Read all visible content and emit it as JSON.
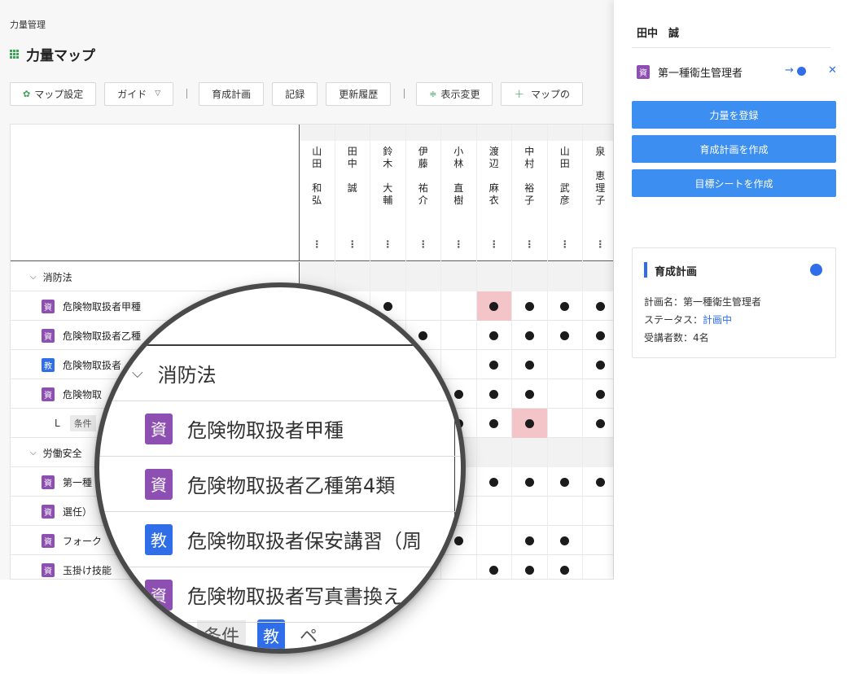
{
  "breadcrumb": "力量管理",
  "page_title": "力量マップ",
  "toolbar": {
    "map_settings": "マップ設定",
    "guide": "ガイド",
    "training_plan": "育成計画",
    "record": "記録",
    "history": "更新履歴",
    "display_change": "表示変更",
    "add_map": "マップの"
  },
  "members": [
    {
      "name": "山田 和弘",
      "chars": [
        "山",
        "田",
        "",
        "和",
        "弘"
      ]
    },
    {
      "name": "田中 誠",
      "chars": [
        "田",
        "中",
        "",
        "誠"
      ]
    },
    {
      "name": "鈴木 大輔",
      "chars": [
        "鈴",
        "木",
        "",
        "大",
        "輔"
      ]
    },
    {
      "name": "伊藤 祐介",
      "chars": [
        "伊",
        "藤",
        "",
        "祐",
        "介"
      ]
    },
    {
      "name": "小林 直樹",
      "chars": [
        "小",
        "林",
        "",
        "直",
        "樹"
      ]
    },
    {
      "name": "渡辺 麻衣",
      "chars": [
        "渡",
        "辺",
        "",
        "麻",
        "衣"
      ]
    },
    {
      "name": "中村 裕子",
      "chars": [
        "中",
        "村",
        "",
        "裕",
        "子"
      ]
    },
    {
      "name": "山田 武彦",
      "chars": [
        "山",
        "田",
        "",
        "武",
        "彦"
      ]
    },
    {
      "name": "泉 恵理子",
      "chars": [
        "泉",
        "",
        "恵",
        "理",
        "子"
      ]
    }
  ],
  "rows": [
    {
      "type": "cat",
      "label": "消防法",
      "cells": [
        0,
        0,
        0,
        0,
        0,
        0,
        0,
        0,
        0
      ]
    },
    {
      "type": "item",
      "badge": "資",
      "badge_kind": "shi",
      "label": "危険物取扱者甲種",
      "cells": [
        0,
        0,
        1,
        0,
        0,
        2,
        1,
        1,
        1
      ]
    },
    {
      "type": "item",
      "badge": "資",
      "badge_kind": "shi",
      "label": "危険物取扱者乙種",
      "cells": [
        0,
        0,
        0,
        1,
        0,
        1,
        1,
        1,
        1
      ]
    },
    {
      "type": "item",
      "badge": "教",
      "badge_kind": "kyo",
      "label": "危険物取扱者",
      "cells": [
        0,
        0,
        0,
        0,
        0,
        1,
        1,
        0,
        1
      ]
    },
    {
      "type": "item",
      "badge": "資",
      "badge_kind": "shi",
      "label": "危険物取",
      "cells": [
        0,
        0,
        0,
        0,
        1,
        1,
        1,
        0,
        1
      ]
    },
    {
      "type": "sub",
      "prefix": "L",
      "label": "条件",
      "cells": [
        0,
        0,
        0,
        0,
        1,
        1,
        2,
        0,
        1
      ]
    },
    {
      "type": "cat",
      "label": "労働安全",
      "cells": [
        0,
        0,
        0,
        0,
        0,
        0,
        0,
        0,
        0
      ]
    },
    {
      "type": "item",
      "badge": "資",
      "badge_kind": "shi",
      "label": "第一種",
      "cells": [
        0,
        0,
        0,
        0,
        1,
        1,
        1,
        1,
        1
      ]
    },
    {
      "type": "item",
      "badge": "資",
      "badge_kind": "shi",
      "label": "選任）",
      "cells": [
        0,
        0,
        0,
        0,
        0,
        0,
        0,
        0,
        0
      ]
    },
    {
      "type": "item",
      "badge": "資",
      "badge_kind": "shi",
      "label": "フォーク",
      "cells": [
        0,
        0,
        0,
        0,
        1,
        0,
        1,
        1,
        0
      ]
    },
    {
      "type": "item",
      "badge": "資",
      "badge_kind": "shi",
      "label": "玉掛け技能",
      "cells": [
        0,
        0,
        0,
        0,
        0,
        1,
        1,
        1,
        0
      ]
    }
  ],
  "panel": {
    "name": "田中　誠",
    "cert_badge": "資",
    "cert_name": "第一種衛生管理者",
    "buttons": [
      "力量を登録",
      "育成計画を作成",
      "目標シートを作成"
    ],
    "card": {
      "title": "育成計画",
      "plan_name_label": "計画名：",
      "plan_name": "第一種衛生管理者",
      "status_label": "ステータス：",
      "status": "計画中",
      "attendees_label": "受講者数：",
      "attendees": "4名"
    }
  },
  "magnifier": {
    "cat_label": "消防法",
    "items": [
      {
        "badge": "資",
        "badge_kind": "shi",
        "label": "危険物取扱者甲種"
      },
      {
        "badge": "資",
        "badge_kind": "shi",
        "label": "危険物取扱者乙種第4類"
      },
      {
        "badge": "教",
        "badge_kind": "kyo",
        "label": "危険物取扱者保安講習（周"
      },
      {
        "badge": "資",
        "badge_kind": "shi",
        "label": "危険物取扱者写真書換え"
      }
    ],
    "bottom_tag": "条件",
    "bottom_badge": "教",
    "bottom_text": "ペ"
  },
  "colors": {
    "accent_green": "#3ba556",
    "primary_blue": "#3c8ff0",
    "badge_purple": "#8e4fb3",
    "badge_blue": "#2f6ee8",
    "highlight_pink": "#f3c4c8"
  }
}
